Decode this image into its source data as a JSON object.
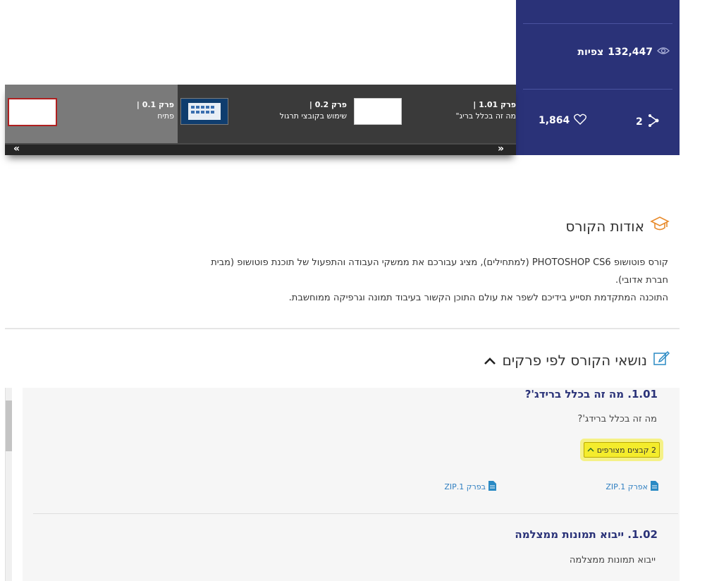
{
  "stats": {
    "views_count": "132,447",
    "views_label": "צפיות",
    "likes_count": "1,864",
    "shares_count": "2",
    "icons": {
      "views": "eye-icon",
      "likes": "heart-icon",
      "shares": "share-icon"
    },
    "panel_color": "#2a3278"
  },
  "carousel": {
    "slides": [
      {
        "title": "פרק 0.1 |",
        "subtitle": "פתיח"
      },
      {
        "title": "פרק 0.2 |",
        "subtitle": "שימוש בקובצי תרגול"
      },
      {
        "title": "פרק 1.01 |",
        "subtitle": "מה זה בכלל בריג\""
      }
    ],
    "prev_label": "«",
    "next_label": "»"
  },
  "about": {
    "heading": "אודות הקורס",
    "paragraph_1": "קורס פוטושופ PHOTOSHOP CS6 (למתחילים), מציג עבורכם את ממשקי העבודה והתפעול של תוכנת פוטושופ (מבית חברת אדובי).",
    "paragraph_2": "התוכנה המתקדמת תסייע בידיכם לשפר את עולם התוכן הקשור בעיבוד תמונה וגרפיקה ממוחשבת."
  },
  "topics": {
    "heading": "נושאי הקורס לפי פרקים",
    "lessons": [
      {
        "title": "1.01. מה זה בכלל ברידג'?",
        "description": "מה זה בכלל ברידג'?",
        "attachments_label": "2 קבצים מצורפים",
        "files": [
          "אפרק 1.ZIP",
          "בפרק 1.ZIP"
        ]
      },
      {
        "title": "1.02.  ייבוא תמונות ממצלמה",
        "description": "ייבוא תמונות ממצלמה"
      }
    ]
  }
}
